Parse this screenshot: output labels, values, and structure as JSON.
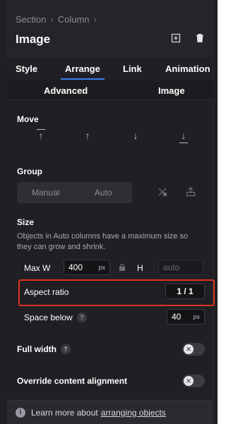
{
  "header": {
    "breadcrumb": [
      "Section",
      "Column"
    ],
    "breadcrumb_sep": "›",
    "title": "Image",
    "icons": [
      "add-icon",
      "trash-icon"
    ]
  },
  "tabs": [
    "Style",
    "Arrange",
    "Link",
    "Animation"
  ],
  "active_tab": "Arrange",
  "subtabs": [
    "Advanced",
    "Image"
  ],
  "move": {
    "label": "Move",
    "buttons": [
      "move-to-top",
      "move-up",
      "move-down",
      "move-to-bottom"
    ]
  },
  "group": {
    "label": "Group",
    "options": [
      "Manual",
      "Auto"
    ]
  },
  "size": {
    "label": "Size",
    "help": "Objects in Auto columns have a maximum size so they can grow and shrink.",
    "max_w_label": "Max W",
    "max_w_value": "400",
    "max_w_unit": "px",
    "h_label": "H",
    "h_placeholder": "auto",
    "aspect_label": "Aspect ratio",
    "aspect_value": "1 / 1",
    "space_label": "Space below",
    "space_help": "?",
    "space_value": "40",
    "space_unit": "px"
  },
  "full_width": {
    "label": "Full width",
    "help": "?",
    "enabled": false
  },
  "override": {
    "label": "Override content alignment",
    "enabled": false
  },
  "footer": {
    "info": "i",
    "text": "Learn more about",
    "link": "arranging objects"
  },
  "colors": {
    "accent": "#3e7cf0",
    "highlight": "#e0321f",
    "panel_bg": "#1f1f24"
  }
}
